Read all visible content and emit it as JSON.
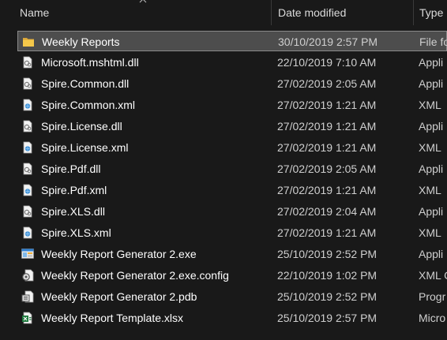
{
  "header": {
    "name_label": "Name",
    "date_label": "Date modified",
    "type_label": "Type"
  },
  "files": [
    {
      "name": "Weekly Reports",
      "date": "30/10/2019 2:57 PM",
      "type": "File fo",
      "icon": "folder-icon",
      "selected": true
    },
    {
      "name": "Microsoft.mshtml.dll",
      "date": "22/10/2019 7:10 AM",
      "type": "Appli",
      "icon": "dll-icon",
      "selected": false
    },
    {
      "name": "Spire.Common.dll",
      "date": "27/02/2019 2:05 AM",
      "type": "Appli",
      "icon": "dll-icon",
      "selected": false
    },
    {
      "name": "Spire.Common.xml",
      "date": "27/02/2019 1:21 AM",
      "type": "XML",
      "icon": "xml-icon",
      "selected": false
    },
    {
      "name": "Spire.License.dll",
      "date": "27/02/2019 1:21 AM",
      "type": "Appli",
      "icon": "dll-icon",
      "selected": false
    },
    {
      "name": "Spire.License.xml",
      "date": "27/02/2019 1:21 AM",
      "type": "XML",
      "icon": "xml-icon",
      "selected": false
    },
    {
      "name": "Spire.Pdf.dll",
      "date": "27/02/2019 2:05 AM",
      "type": "Appli",
      "icon": "dll-icon",
      "selected": false
    },
    {
      "name": "Spire.Pdf.xml",
      "date": "27/02/2019 1:21 AM",
      "type": "XML",
      "icon": "xml-icon",
      "selected": false
    },
    {
      "name": "Spire.XLS.dll",
      "date": "27/02/2019 2:04 AM",
      "type": "Appli",
      "icon": "dll-icon",
      "selected": false
    },
    {
      "name": "Spire.XLS.xml",
      "date": "27/02/2019 1:21 AM",
      "type": "XML",
      "icon": "xml-icon",
      "selected": false
    },
    {
      "name": "Weekly Report Generator 2.exe",
      "date": "25/10/2019 2:52 PM",
      "type": "Appli",
      "icon": "exe-icon",
      "selected": false
    },
    {
      "name": "Weekly Report Generator 2.exe.config",
      "date": "22/10/2019 1:02 PM",
      "type": "XML C",
      "icon": "config-icon",
      "selected": false
    },
    {
      "name": "Weekly Report Generator 2.pdb",
      "date": "25/10/2019 2:52 PM",
      "type": "Progr",
      "icon": "pdb-icon",
      "selected": false
    },
    {
      "name": "Weekly Report Template.xlsx",
      "date": "25/10/2019 2:57 PM",
      "type": "Micro",
      "icon": "excel-icon",
      "selected": false
    }
  ]
}
